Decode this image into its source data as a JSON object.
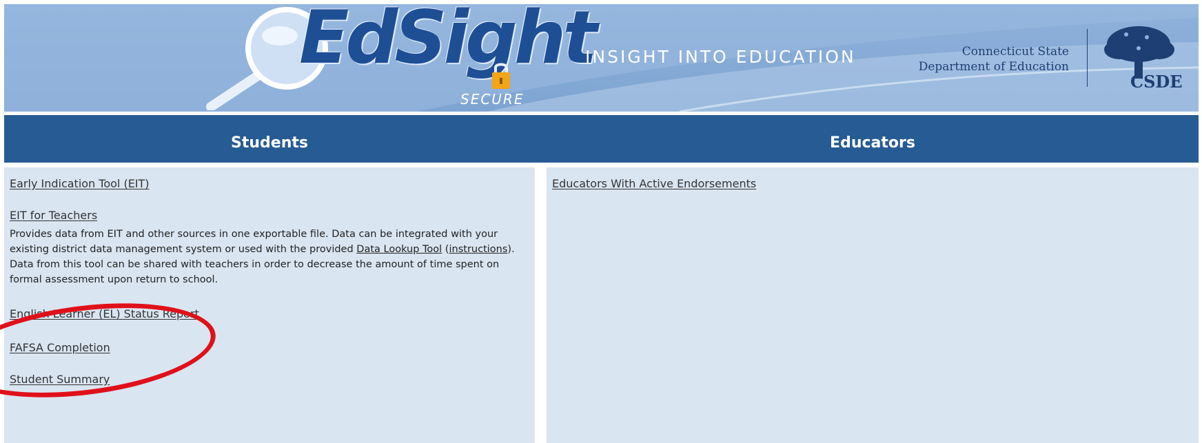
{
  "banner": {
    "logo": "EdSight",
    "logo_sub": "SECURE",
    "tagline": "INSIGHT INTO EDUCATION",
    "agency_line1": "Connecticut State",
    "agency_line2": "Department of Education",
    "agency_abbr": "CSDE"
  },
  "nav": {
    "students": "Students",
    "educators": "Educators"
  },
  "students": {
    "items": [
      {
        "label": "Early Indication Tool (EIT)"
      },
      {
        "label": "EIT for Teachers"
      },
      {
        "label": "English Learner (EL) Status Report"
      },
      {
        "label": "FAFSA Completion"
      },
      {
        "label": "Student Summary"
      }
    ],
    "eit_description": {
      "part1": "Provides data from EIT and other sources in one exportable file. Data can be integrated with your existing district data management system or used with the provided ",
      "link1": "Data Lookup Tool",
      "part2": " (",
      "link2": "instructions",
      "part3": "). Data from this tool can be shared with teachers in order to decrease the amount of time spent on formal assessment upon return to school."
    }
  },
  "educators": {
    "items": [
      {
        "label": "Educators With Active Endorsements"
      }
    ]
  },
  "colors": {
    "nav_blue": "#275b93",
    "panel_bg": "#d9e5f1",
    "logo_blue": "#1e4f95",
    "annotation_red": "#e0101a"
  }
}
